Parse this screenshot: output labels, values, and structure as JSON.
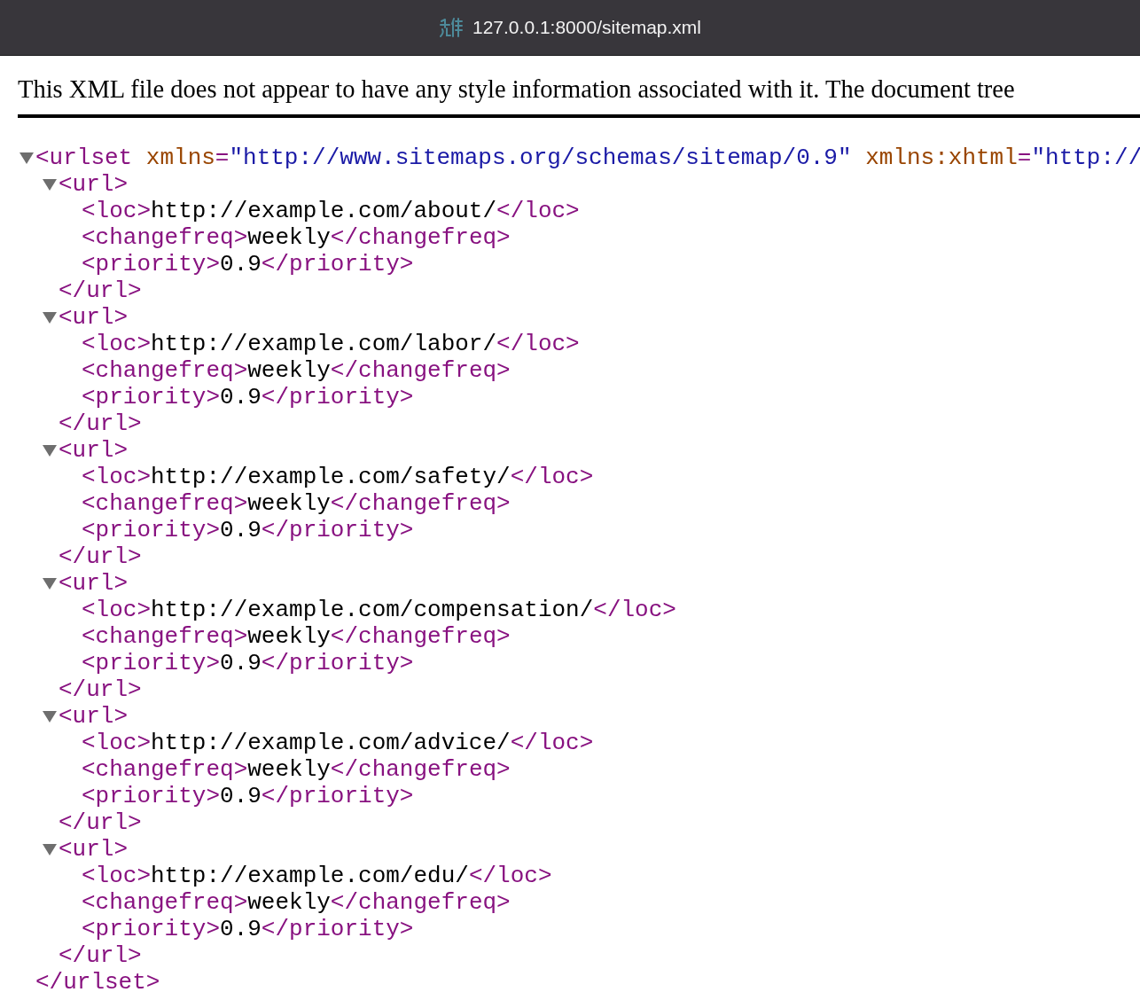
{
  "window": {
    "title": "127.0.0.1:8000/sitemap.xml"
  },
  "notice": "This XML file does not appear to have any style information associated with it. The document tree",
  "root": {
    "open": "<urlset",
    "attributes": [
      {
        "name": "xmlns",
        "equals": "=",
        "value": "\"http://www.sitemaps.org/schemas/sitemap/0.9\""
      },
      {
        "name": "xmlns:xhtml",
        "equals": "=",
        "value": "\"http://"
      }
    ],
    "expanded": true,
    "close": "</urlset>",
    "children": [
      {
        "open": "<url>",
        "expanded": true,
        "close": "</url>",
        "children": [
          {
            "open": "<loc>",
            "text": "http://example.com/about/",
            "close": "</loc>"
          },
          {
            "open": "<changefreq>",
            "text": "weekly",
            "close": "</changefreq>"
          },
          {
            "open": "<priority>",
            "text": "0.9",
            "close": "</priority>"
          }
        ]
      },
      {
        "open": "<url>",
        "expanded": true,
        "close": "</url>",
        "children": [
          {
            "open": "<loc>",
            "text": "http://example.com/labor/",
            "close": "</loc>"
          },
          {
            "open": "<changefreq>",
            "text": "weekly",
            "close": "</changefreq>"
          },
          {
            "open": "<priority>",
            "text": "0.9",
            "close": "</priority>"
          }
        ]
      },
      {
        "open": "<url>",
        "expanded": true,
        "close": "</url>",
        "children": [
          {
            "open": "<loc>",
            "text": "http://example.com/safety/",
            "close": "</loc>"
          },
          {
            "open": "<changefreq>",
            "text": "weekly",
            "close": "</changefreq>"
          },
          {
            "open": "<priority>",
            "text": "0.9",
            "close": "</priority>"
          }
        ]
      },
      {
        "open": "<url>",
        "expanded": true,
        "close": "</url>",
        "children": [
          {
            "open": "<loc>",
            "text": "http://example.com/compensation/",
            "close": "</loc>"
          },
          {
            "open": "<changefreq>",
            "text": "weekly",
            "close": "</changefreq>"
          },
          {
            "open": "<priority>",
            "text": "0.9",
            "close": "</priority>"
          }
        ]
      },
      {
        "open": "<url>",
        "expanded": true,
        "close": "</url>",
        "children": [
          {
            "open": "<loc>",
            "text": "http://example.com/advice/",
            "close": "</loc>"
          },
          {
            "open": "<changefreq>",
            "text": "weekly",
            "close": "</changefreq>"
          },
          {
            "open": "<priority>",
            "text": "0.9",
            "close": "</priority>"
          }
        ]
      },
      {
        "open": "<url>",
        "expanded": true,
        "close": "</url>",
        "children": [
          {
            "open": "<loc>",
            "text": "http://example.com/edu/",
            "close": "</loc>"
          },
          {
            "open": "<changefreq>",
            "text": "weekly",
            "close": "</changefreq>"
          },
          {
            "open": "<priority>",
            "text": "0.9",
            "close": "</priority>"
          }
        ]
      }
    ]
  }
}
